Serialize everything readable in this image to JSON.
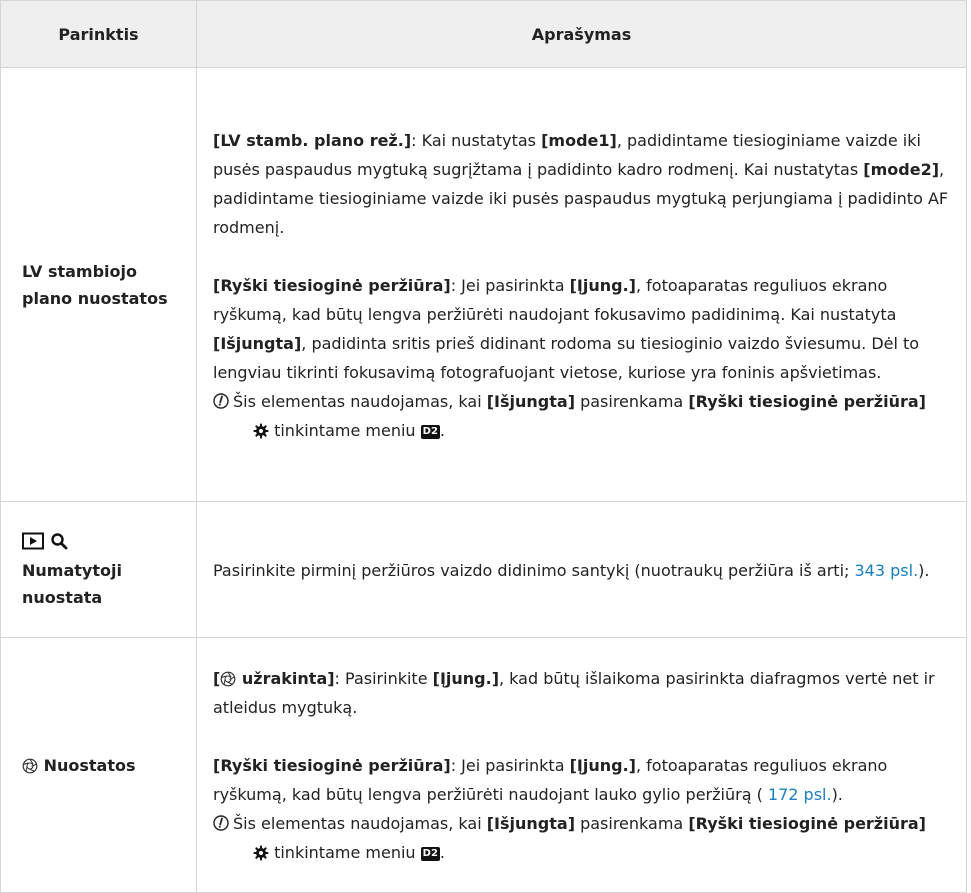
{
  "header": {
    "col1": "Parinktis",
    "col2": "Aprašymas"
  },
  "row1": {
    "option_line1": "LV stambiojo",
    "option_line2": "plano nuostatos",
    "p1": {
      "b1": "[LV stamb. plano rež.]",
      "t1": ": Kai nustatytas ",
      "b2": "[mode1]",
      "t2": ", padidintame tiesioginiame vaizde iki pusės paspaudus mygtuką sugrįžtama į padidinto kadro rodmenį. Kai nustatytas ",
      "b3": "[mode2]",
      "t3": ", padidintame tiesioginiame vaizde iki pusės paspaudus mygtuką perjungiama į padidinto AF rodmenį."
    },
    "p2": {
      "b1": "[Ryški tiesioginė peržiūra]",
      "t1": ": Jei pasirinkta ",
      "b2": "[Įjung.]",
      "t2": ", fotoaparatas reguliuos ekrano ryškumą, kad būtų lengva peržiūrėti naudojant fokusavimo padidinimą. Kai nustatyta ",
      "b3": "[Išjungta]",
      "t3": ", padidinta sritis prieš didinant rodoma su tiesioginio vaizdo šviesumu. Dėl to lengviau tikrinti fokusavimą fotografuojant vietose, kuriose yra foninis apšvietimas."
    },
    "note": {
      "t1": "Šis elementas naudojamas, kai ",
      "b1": "[Išjungta]",
      "t2": " pasirenkama ",
      "b2": "[Ryški tiesioginė peržiūra]",
      "t3": " tinkintame meniu ",
      "menu": "D2",
      "t4": "."
    }
  },
  "row2": {
    "option_line1": "Numatytoji",
    "option_line2": "nuostata",
    "desc": "Pasirinkite pirminį peržiūros vaizdo didinimo santykį (nuotraukų peržiūra iš arti; ",
    "link": "343 psl.",
    "desc_end": ")."
  },
  "row3": {
    "option": "Nuostatos",
    "p1": {
      "b1_pre": "[",
      "b1_post": " užrakinta]",
      "t1": ": Pasirinkite ",
      "b2": "[Įjung.]",
      "t2": ", kad būtų išlaikoma pasirinkta diafragmos vertė net ir atleidus mygtuką."
    },
    "p2": {
      "b1": "[Ryški tiesioginė peržiūra]",
      "t1": ": Jei pasirinkta ",
      "b2": "[Įjung.]",
      "t2": ", fotoaparatas reguliuos ekrano ryškumą, kad būtų lengva peržiūrėti naudojant lauko gylio peržiūrą (",
      "link": " 172 psl.",
      "t3": ")."
    },
    "note": {
      "t1": "Šis elementas naudojamas, kai ",
      "b1": "[Išjungta]",
      "t2": " pasirenkama ",
      "b2": "[Ryški tiesioginė peržiūra]",
      "t3": " tinkintame meniu ",
      "menu": "D2",
      "t4": "."
    }
  },
  "icons": [
    "playback-icon",
    "magnify-icon",
    "aperture-icon",
    "gear-icon",
    "note-icon",
    "custom-menu-d2-icon"
  ],
  "colors": {
    "link": "#1a7fc1",
    "header_bg": "#efefef",
    "border": "#d6d6d6"
  }
}
